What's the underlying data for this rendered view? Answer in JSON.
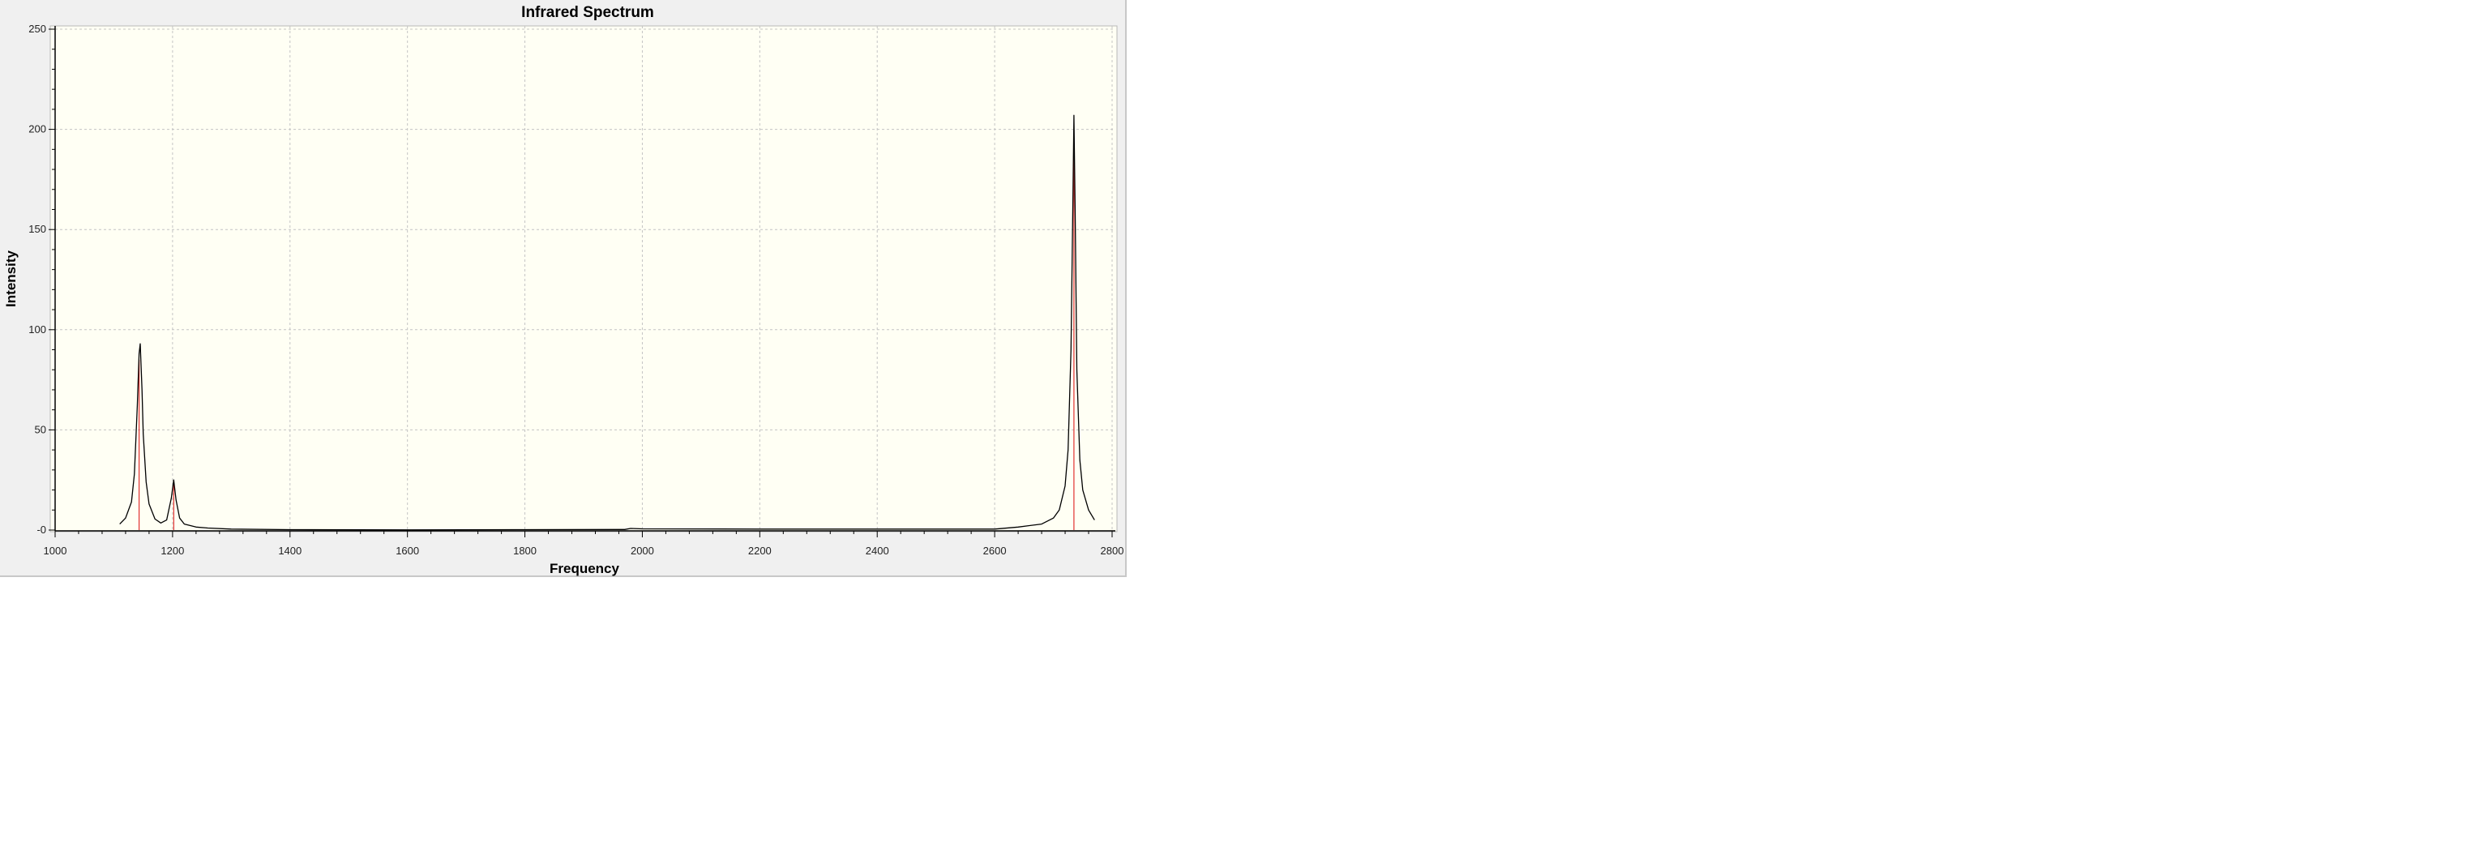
{
  "chart_data": {
    "type": "line",
    "title": "Infrared Spectrum",
    "xlabel": "Frequency",
    "ylabel": "Intensity",
    "xlim": [
      1000,
      2800
    ],
    "ylim": [
      0,
      250
    ],
    "x_ticks": [
      1000,
      1200,
      1400,
      1600,
      1800,
      2000,
      2200,
      2400,
      2600,
      2800
    ],
    "y_ticks": [
      0,
      50,
      100,
      150,
      200,
      250
    ],
    "y_tick_labels": [
      "-0",
      "50",
      "100",
      "150",
      "200",
      "250"
    ],
    "grid": true,
    "series": [
      {
        "color": "#000000",
        "x": [
          1110,
          1120,
          1130,
          1135,
          1140,
          1143,
          1145,
          1148,
          1150,
          1155,
          1160,
          1170,
          1180,
          1190,
          1198,
          1202,
          1206,
          1212,
          1220,
          1240,
          1260,
          1300,
          1400,
          1600,
          1800,
          1970,
          1980,
          2000,
          2200,
          2400,
          2600,
          2640,
          2680,
          2700,
          2710,
          2720,
          2725,
          2730,
          2733,
          2735,
          2737,
          2740,
          2745,
          2750,
          2760,
          2770
        ],
        "y": [
          3,
          6,
          14,
          28,
          62,
          88,
          93,
          70,
          48,
          24,
          13,
          5.5,
          3.5,
          5,
          16,
          25,
          15,
          6,
          3,
          1.5,
          1,
          0.5,
          0.2,
          0.1,
          0.2,
          0.3,
          0.8,
          0.6,
          0.5,
          0.5,
          0.5,
          1.5,
          3,
          6,
          10,
          22,
          40,
          90,
          160,
          207,
          160,
          80,
          35,
          20,
          10,
          5
        ]
      }
    ],
    "sticks": {
      "color": "#e03030",
      "x": [
        1143,
        1202,
        2735
      ],
      "y": [
        85,
        23,
        200
      ]
    },
    "background": "#fffff4",
    "window_background": "#f0f0f0"
  }
}
